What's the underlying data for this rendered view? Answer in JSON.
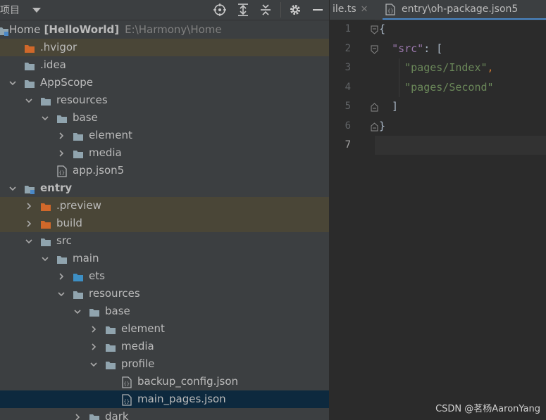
{
  "project_panel": {
    "title": "项目",
    "toolbar": [
      "locate-icon",
      "expand-all-icon",
      "collapse-all-icon",
      "gear-icon",
      "minimize-icon"
    ]
  },
  "tree": [
    {
      "label": "Home",
      "bold_part": "[HelloWorld]",
      "path": "E:\\Harmony\\Home",
      "icon": "module-icon",
      "arrow": "open",
      "indent": 0
    },
    {
      "label": ".hvigor",
      "icon": "folder-excluded-icon",
      "arrow": "none",
      "indent": 1,
      "excluded": true
    },
    {
      "label": ".idea",
      "icon": "folder-icon",
      "arrow": "none",
      "indent": 1
    },
    {
      "label": "AppScope",
      "icon": "folder-icon",
      "arrow": "open",
      "indent": 1
    },
    {
      "label": "resources",
      "icon": "folder-icon",
      "arrow": "open",
      "indent": 2
    },
    {
      "label": "base",
      "icon": "folder-icon",
      "arrow": "open",
      "indent": 3
    },
    {
      "label": "element",
      "icon": "folder-icon",
      "arrow": "closed",
      "indent": 4
    },
    {
      "label": "media",
      "icon": "folder-icon",
      "arrow": "closed",
      "indent": 4
    },
    {
      "label": "app.json5",
      "icon": "json-file-icon",
      "arrow": "none",
      "indent": 3
    },
    {
      "label": "entry",
      "icon": "module-icon",
      "arrow": "open",
      "indent": 1,
      "bold": true
    },
    {
      "label": ".preview",
      "icon": "folder-excluded-icon",
      "arrow": "closed",
      "indent": 2,
      "excluded": true
    },
    {
      "label": "build",
      "icon": "folder-excluded-icon",
      "arrow": "closed",
      "indent": 2,
      "excluded": true
    },
    {
      "label": "src",
      "icon": "folder-icon",
      "arrow": "open",
      "indent": 2
    },
    {
      "label": "main",
      "icon": "folder-icon",
      "arrow": "open",
      "indent": 3
    },
    {
      "label": "ets",
      "icon": "folder-source-icon",
      "arrow": "closed",
      "indent": 4
    },
    {
      "label": "resources",
      "icon": "folder-icon",
      "arrow": "open",
      "indent": 4
    },
    {
      "label": "base",
      "icon": "folder-icon",
      "arrow": "open",
      "indent": 5
    },
    {
      "label": "element",
      "icon": "folder-icon",
      "arrow": "closed",
      "indent": 6
    },
    {
      "label": "media",
      "icon": "folder-icon",
      "arrow": "closed",
      "indent": 6
    },
    {
      "label": "profile",
      "icon": "folder-icon",
      "arrow": "open",
      "indent": 6
    },
    {
      "label": "backup_config.json",
      "icon": "json-file-icon",
      "arrow": "none",
      "indent": 7
    },
    {
      "label": "main_pages.json",
      "icon": "json-file-icon",
      "arrow": "none",
      "indent": 7,
      "selected": true
    },
    {
      "label": "dark",
      "icon": "folder-icon",
      "arrow": "closed",
      "indent": 5
    }
  ],
  "tabs": [
    {
      "label": "ile.ts",
      "close": "✕",
      "icon": "none"
    },
    {
      "label": "entry\\oh-package.json5",
      "icon": "json-file-icon",
      "active": true
    }
  ],
  "editor": {
    "line_numbers": [
      "1",
      "2",
      "3",
      "4",
      "5",
      "6",
      "7"
    ],
    "lines": [
      {
        "parts": [
          {
            "t": "{",
            "c": "brace"
          }
        ]
      },
      {
        "parts": [
          {
            "t": "  ",
            "c": "brace"
          },
          {
            "t": "\"src\"",
            "c": "key"
          },
          {
            "t": ": ",
            "c": "brace"
          },
          {
            "t": "[",
            "c": "brace"
          }
        ]
      },
      {
        "parts": [
          {
            "t": "    ",
            "c": "brace"
          },
          {
            "t": "\"pages/Index\"",
            "c": "str"
          },
          {
            "t": ",",
            "c": "punct"
          }
        ]
      },
      {
        "parts": [
          {
            "t": "    ",
            "c": "brace"
          },
          {
            "t": "\"pages/Second\"",
            "c": "str"
          }
        ]
      },
      {
        "parts": [
          {
            "t": "  ]",
            "c": "brace"
          }
        ]
      },
      {
        "parts": [
          {
            "t": "}",
            "c": "brace"
          }
        ]
      },
      {
        "parts": []
      }
    ],
    "current_line": "7"
  },
  "watermark": "CSDN @茗杨AaronYang",
  "colors": {
    "accent": "#4a88c7",
    "selection": "#0d293e",
    "excluded": "#4a4637"
  }
}
